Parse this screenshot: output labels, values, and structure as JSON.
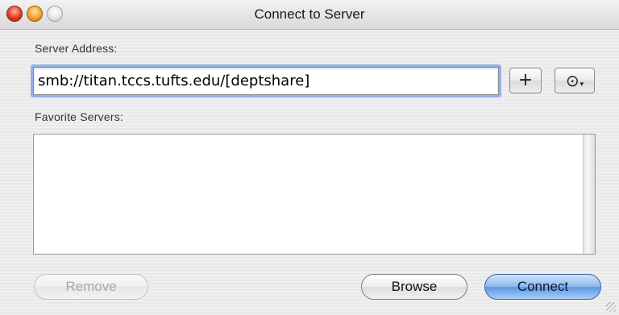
{
  "window": {
    "title": "Connect to Server"
  },
  "server_address": {
    "label": "Server Address:",
    "value": "smb://titan.tccs.tufts.edu/[deptshare]"
  },
  "buttons": {
    "add_label": "+",
    "recent_label": "⊙",
    "recent_caret": "▾",
    "remove_label": "Remove",
    "browse_label": "Browse",
    "connect_label": "Connect"
  },
  "favorites": {
    "label": "Favorite Servers:",
    "items": []
  },
  "icons": {
    "add": "plus-icon",
    "recent": "clock-icon"
  },
  "colors": {
    "accent": "#6fa2e8",
    "focus_ring": "#8fb3e6"
  }
}
